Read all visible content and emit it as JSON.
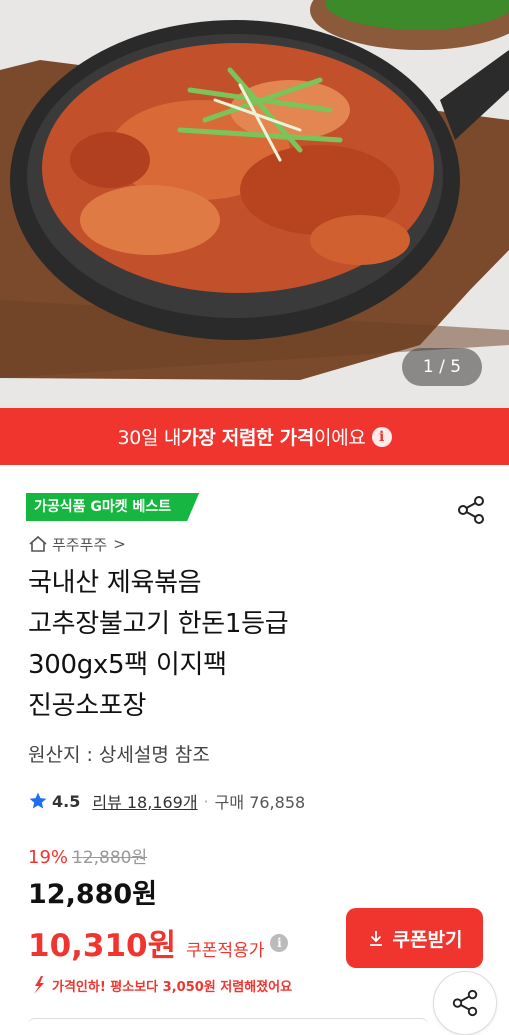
{
  "hero": {
    "image_alt": "food photo",
    "counter": "1 / 5"
  },
  "banner": {
    "pre": "30일 내 ",
    "highlight": "가장 저렴한 가격",
    "post": "이에요",
    "info_glyph": "i"
  },
  "badge": {
    "label": "가공식품 G마켓 베스트"
  },
  "store": {
    "name": "푸주푸주",
    "chevron": ">"
  },
  "product": {
    "title_lines": [
      "국내산 제육볶음",
      "고추장불고기 한돈1등급",
      "300gx5팩 이지팩",
      "진공소포장"
    ],
    "origin": "원산지 : 상세설명 참조"
  },
  "rating": {
    "score": "4.5",
    "reviews": "리뷰 18,169개",
    "dot": "·",
    "sales": "구매 76,858"
  },
  "pricing": {
    "discount": "19%",
    "original": "12,880원",
    "price": "12,880원",
    "coupon_price": "10,310원",
    "coupon_label": "쿠폰적용가",
    "coupon_info_glyph": "i"
  },
  "coupon_button": {
    "label": "쿠폰받기"
  },
  "price_drop": {
    "text": "가격인하! 평소보다 3,050원 저렴해졌어요"
  },
  "colors": {
    "accent": "#f0352f",
    "badge_green": "#16b640",
    "star_blue": "#1e6ff0"
  },
  "icons": [
    "share-icon",
    "home-icon",
    "chevron-right-icon",
    "star-icon",
    "info-icon",
    "download-icon",
    "down-arrow-icon"
  ]
}
